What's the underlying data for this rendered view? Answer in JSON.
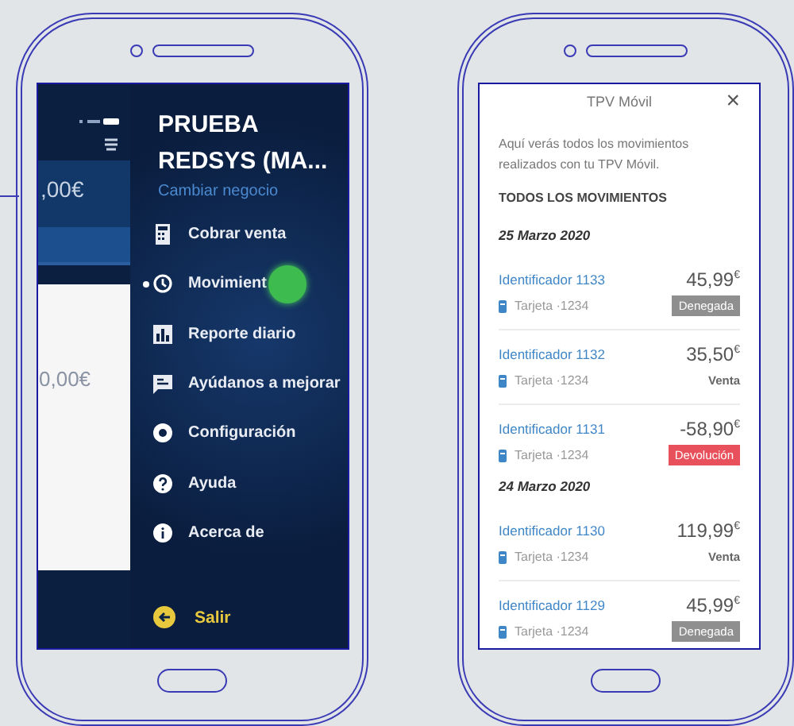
{
  "phones": [
    {
      "kind": "menu",
      "background_app": {
        "amounts": [
          ",00€",
          "0,00€"
        ]
      },
      "menu": {
        "business": "PRUEBA REDSYS (MA...",
        "change_link": "Cambiar negocio",
        "items": [
          {
            "kind": "calculator",
            "label": "Cobrar venta",
            "selected": false
          },
          {
            "kind": "history",
            "label": "Movimient",
            "selected": true
          },
          {
            "kind": "chart",
            "label": "Reporte diario",
            "selected": false
          },
          {
            "kind": "feedback",
            "label": "Ayúdanos a mejorar",
            "selected": false
          },
          {
            "kind": "settings",
            "label": "Configuración",
            "selected": false
          },
          {
            "kind": "help",
            "label": "Ayuda",
            "selected": false
          },
          {
            "kind": "info",
            "label": "Acerca de",
            "selected": false
          }
        ],
        "logout": "Salir"
      }
    },
    {
      "kind": "movements",
      "title": "TPV Móvil",
      "close": "×",
      "intro": "Aquí verás todos los movimientos realizados con tu TPV Móvil.",
      "heading": "TODOS LOS MOVIMIENTOS",
      "groups": [
        {
          "date": "25 Marzo 2020",
          "items": [
            {
              "id": "Identificador 1133",
              "amount": "45,99$^{€}$",
              "card": "Tarjeta ·1234",
              "status": {
                "kind": "denied",
                "label": "Denegada"
              }
            },
            {
              "id": "Identificador 1132",
              "amount": "35,50$^{€}$",
              "card": "Tarjeta ·1234",
              "status": {
                "kind": "sale",
                "label": "Venta"
              }
            },
            {
              "id": "Identificador 1131",
              "amount": "-58,90$^{€}$",
              "card": "Tarjeta ·1234",
              "status": {
                "kind": "refund",
                "label": "Devolución"
              }
            }
          ]
        },
        {
          "date": "24 Marzo 2020",
          "items": [
            {
              "id": "Identificador 1130",
              "amount": "119,99$^{€}$",
              "card": "Tarjeta ·1234",
              "status": {
                "kind": "sale",
                "label": "Venta"
              }
            },
            {
              "id": "Identificador 1129",
              "amount": "45,99$^{€}$",
              "card": "Tarjeta ·1234",
              "status": {
                "kind": "denied",
                "label": "Denegada"
              }
            }
          ]
        }
      ]
    }
  ]
}
